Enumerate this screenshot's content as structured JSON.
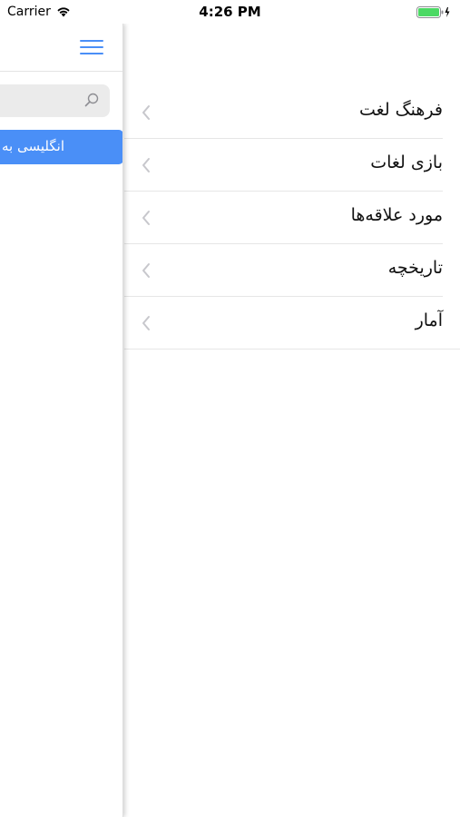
{
  "status_bar": {
    "carrier": "Carrier",
    "time": "4:26 PM",
    "icons": [
      "wifi-icon",
      "battery-icon"
    ]
  },
  "drawer": {
    "menu_icon": "hamburger-icon",
    "search": {
      "placeholder": "",
      "value": "",
      "icon": "search-icon"
    },
    "selected_item": {
      "label": "انگلیسی به"
    }
  },
  "menu": {
    "items": [
      {
        "label": "فرهنگ لغت",
        "icon": "chevron-left-icon"
      },
      {
        "label": "بازی لغات",
        "icon": "chevron-left-icon"
      },
      {
        "label": "مورد علاقه‌ها",
        "icon": "chevron-left-icon"
      },
      {
        "label": "تاریخچه",
        "icon": "chevron-left-icon"
      },
      {
        "label": "آمار",
        "icon": "chevron-left-icon"
      }
    ]
  },
  "colors": {
    "accent": "#4a8ff7",
    "icon_blue": "#4a8ff7",
    "chevron": "#c7c7cc",
    "battery": "#4cd964",
    "search_bg": "#ebebeb"
  }
}
